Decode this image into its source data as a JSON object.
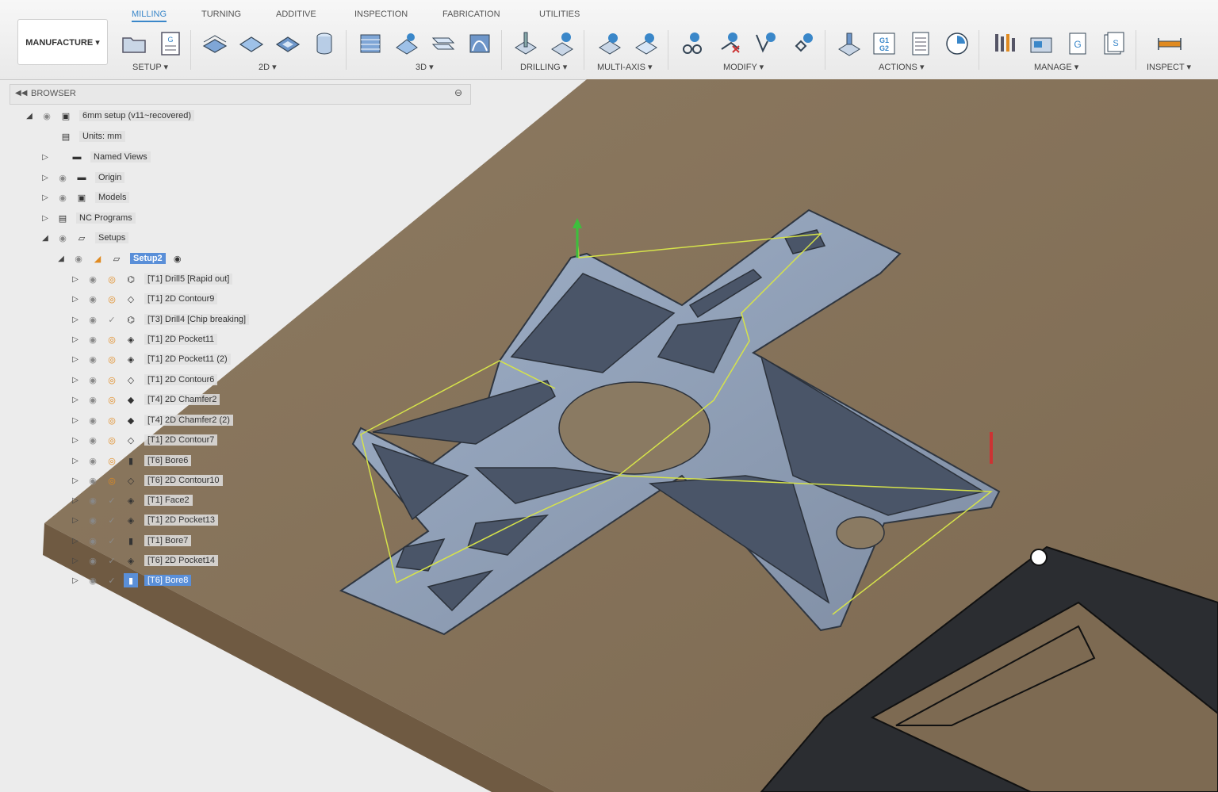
{
  "toolbar": {
    "workspace_label": "MANUFACTURE ▾",
    "tabs": [
      {
        "label": "MILLING",
        "active": true
      },
      {
        "label": "TURNING",
        "active": false
      },
      {
        "label": "ADDITIVE",
        "active": false
      },
      {
        "label": "INSPECTION",
        "active": false
      },
      {
        "label": "FABRICATION",
        "active": false
      },
      {
        "label": "UTILITIES",
        "active": false
      }
    ],
    "groups": [
      "SETUP ▾",
      "2D ▾",
      "3D ▾",
      "DRILLING ▾",
      "MULTI-AXIS ▾",
      "MODIFY ▾",
      "ACTIONS ▾",
      "MANAGE ▾",
      "INSPECT ▾"
    ]
  },
  "browser": {
    "title": "BROWSER",
    "items": [
      {
        "label": "6mm setup (v11~recovered)",
        "icon": "document-icon"
      },
      {
        "label": "Units: mm",
        "icon": "units-icon"
      },
      {
        "label": "Named Views",
        "icon": "folder-icon"
      },
      {
        "label": "Origin",
        "icon": "folder-icon"
      },
      {
        "label": "Models",
        "icon": "model-icon"
      },
      {
        "label": "NC Programs",
        "icon": "nc-program-icon"
      },
      {
        "label": "Setups",
        "icon": "setups-icon"
      },
      {
        "label": "Setup2",
        "icon": "setup-icon"
      },
      {
        "label": "[T1] Drill5 [Rapid out]",
        "icon": "drill-icon"
      },
      {
        "label": "[T1] 2D Contour9",
        "icon": "contour-icon"
      },
      {
        "label": "[T3] Drill4 [Chip breaking]",
        "icon": "drill-icon"
      },
      {
        "label": "[T1] 2D Pocket11",
        "icon": "pocket-icon"
      },
      {
        "label": "[T1] 2D Pocket11 (2)",
        "icon": "pocket-icon"
      },
      {
        "label": "[T1] 2D Contour6",
        "icon": "contour-icon"
      },
      {
        "label": "[T4] 2D Chamfer2",
        "icon": "chamfer-icon"
      },
      {
        "label": "[T4] 2D Chamfer2 (2)",
        "icon": "chamfer-icon"
      },
      {
        "label": "[T1] 2D Contour7",
        "icon": "contour-icon"
      },
      {
        "label": "[T6] Bore6",
        "icon": "bore-icon"
      },
      {
        "label": "[T6] 2D Contour10",
        "icon": "contour-icon"
      },
      {
        "label": "[T1] Face2",
        "icon": "face-icon"
      },
      {
        "label": "[T1] 2D Pocket13",
        "icon": "pocket-icon"
      },
      {
        "label": "[T1] Bore7",
        "icon": "bore-icon"
      },
      {
        "label": "[T6] 2D Pocket14",
        "icon": "pocket-icon"
      },
      {
        "label": "[T6] Bore8",
        "icon": "bore-icon"
      }
    ]
  },
  "colors": {
    "accent": "#3a87c9",
    "selection": "#5a8fd8",
    "stock": "#8c7254",
    "part": "#8a97ad"
  }
}
